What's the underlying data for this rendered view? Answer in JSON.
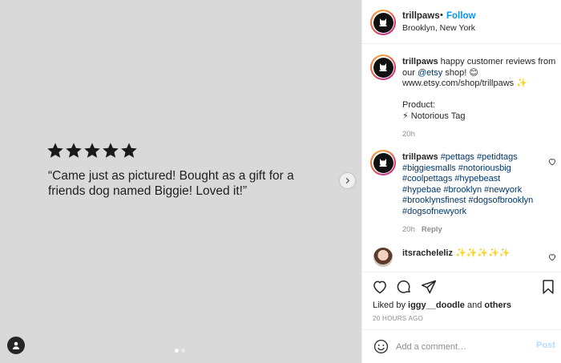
{
  "media": {
    "rating_stars": 5,
    "quote": "“Came just as pictured! Bought as a gift for a friends dog named Biggie! Loved it!”",
    "slide_count": 2,
    "active_slide": 1
  },
  "header": {
    "username": "trillpaws",
    "separator": "•",
    "follow_label": "Follow",
    "location": "Brooklyn, New York"
  },
  "caption": {
    "username": "trillpaws",
    "text_1": " happy customer reviews from our ",
    "mention": "@etsy",
    "text_2": " shop! 😊",
    "url": "www.etsy.com/shop/trillpaws ✨",
    "product_label": "Product:",
    "product_line": "⚡ Notorious Tag",
    "time": "20h"
  },
  "hashtag_comment": {
    "username": "trillpaws",
    "hashtags": "#pettags #petidtags #biggiesmalls #notoriousbig #coolpettags #hypebeast #hypebae #brooklyn #newyork #brooklynsfinest #dogsofbrooklyn #dogsofnewyork",
    "time": "20h",
    "reply_label": "Reply"
  },
  "user_comment": {
    "username": "itsracheleliz",
    "text": " ✨✨✨✨✨"
  },
  "engagement": {
    "liked_prefix": "Liked by ",
    "liked_user": "iggy__doodle",
    "liked_mid": " and ",
    "liked_others": "others",
    "timestamp": "20 HOURS AGO"
  },
  "comment_box": {
    "placeholder": "Add a comment…",
    "post_label": "Post"
  },
  "icons": {
    "avatar": "dog-logo-icon",
    "like": "heart-icon",
    "comment": "comment-bubble-icon",
    "share": "paper-plane-icon",
    "save": "bookmark-icon",
    "emoji": "smiley-icon",
    "next": "chevron-right-icon",
    "tags": "user-icon"
  },
  "colors": {
    "link": "#0095f6",
    "hashtag": "#00376b",
    "muted": "#8e8e8e",
    "post_disabled": "#b3dbff"
  }
}
